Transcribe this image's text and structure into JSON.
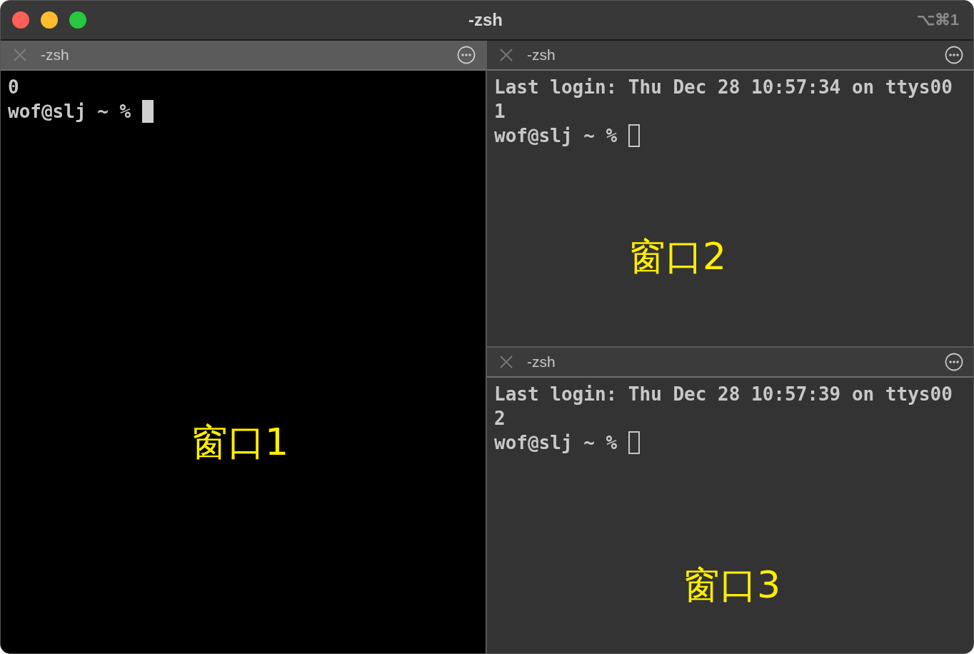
{
  "window": {
    "title": "-zsh",
    "shortcut": "⌥⌘1"
  },
  "panes": [
    {
      "tab": {
        "label": "-zsh",
        "selected": true
      },
      "lines": [
        "0"
      ],
      "prompt": "wof@slj ~ %",
      "focused": true,
      "annotation": "窗口1"
    },
    {
      "tab": {
        "label": "-zsh",
        "selected": false
      },
      "lines": [
        "Last login: Thu Dec 28 10:57:34 on ttys00",
        "1"
      ],
      "prompt": "wof@slj ~ %",
      "focused": false,
      "annotation": "窗口2"
    },
    {
      "tab": {
        "label": "-zsh",
        "selected": false
      },
      "lines": [
        "Last login: Thu Dec 28 10:57:39 on ttys00",
        "2"
      ],
      "prompt": "wof@slj ~ %",
      "focused": false,
      "annotation": "窗口3"
    }
  ]
}
